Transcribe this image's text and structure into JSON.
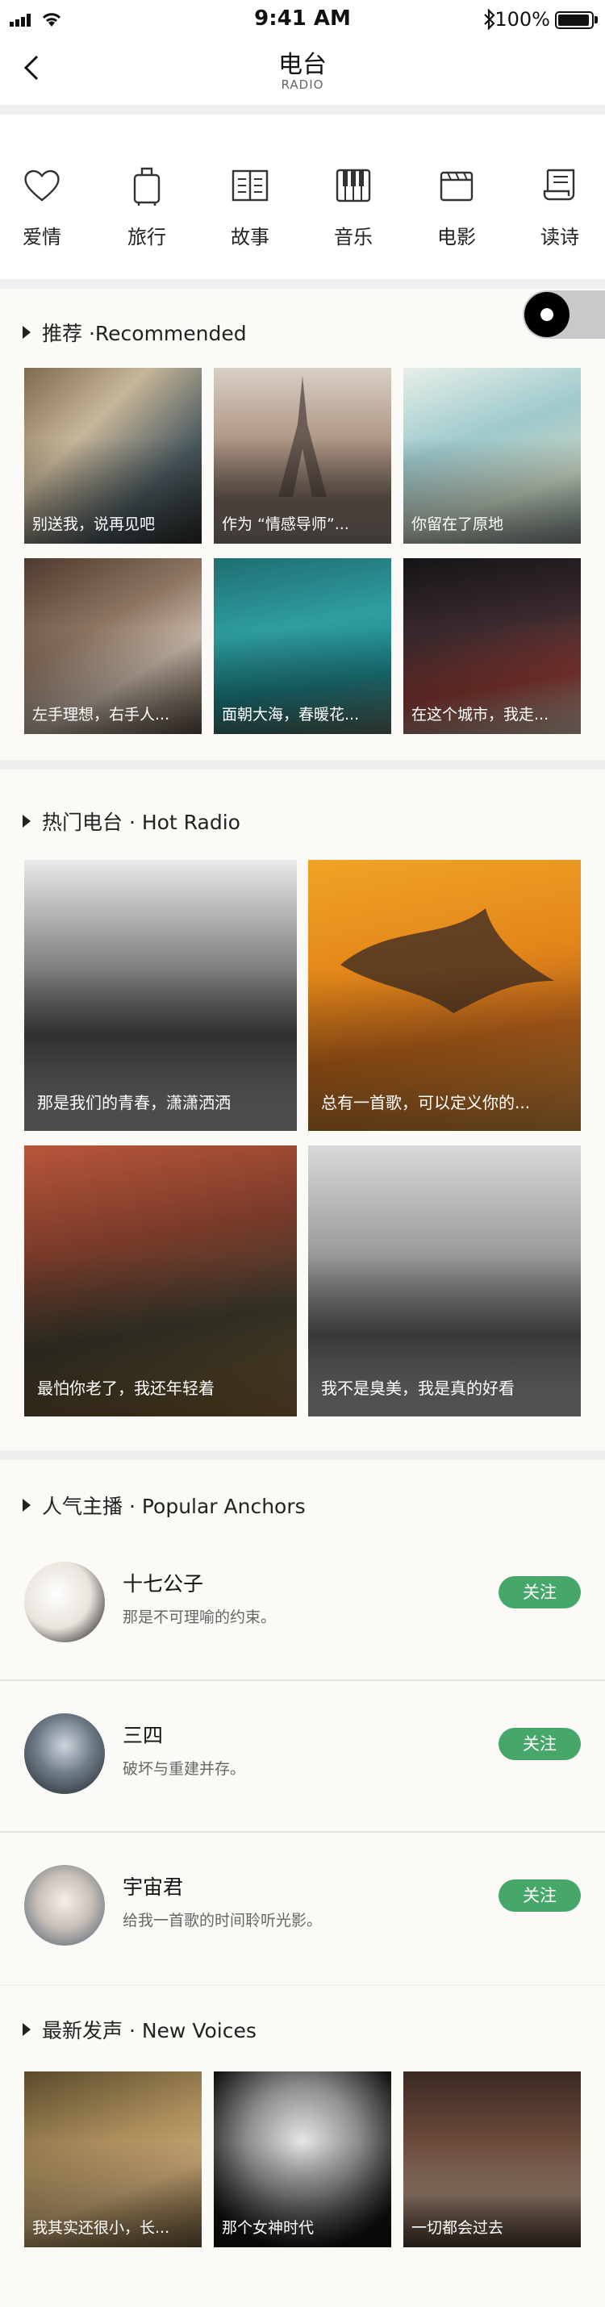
{
  "status_bar": {
    "time": "9:41 AM",
    "battery": "100%"
  },
  "header": {
    "title": "电台",
    "subtitle": "RADIO"
  },
  "categories": [
    {
      "label": "爱情",
      "icon": "heart-icon"
    },
    {
      "label": "旅行",
      "icon": "suitcase-icon"
    },
    {
      "label": "故事",
      "icon": "book-icon"
    },
    {
      "label": "音乐",
      "icon": "piano-icon"
    },
    {
      "label": "电影",
      "icon": "clapperboard-icon"
    },
    {
      "label": "读诗",
      "icon": "scroll-icon"
    }
  ],
  "recommended": {
    "title": "推荐 ·Recommended",
    "items": [
      {
        "caption": "别送我，说再见吧"
      },
      {
        "caption": "作为 “情感导师”..."
      },
      {
        "caption": "你留在了原地"
      },
      {
        "caption": "左手理想，右手人..."
      },
      {
        "caption": "面朝大海，春暖花..."
      },
      {
        "caption": "在这个城市，我走..."
      }
    ]
  },
  "hot_radio": {
    "title": "热门电台 · Hot Radio",
    "items": [
      {
        "caption": "那是我们的青春，潇潇洒洒"
      },
      {
        "caption": "总有一首歌，可以定义你的..."
      },
      {
        "caption": "最怕你老了，我还年轻着"
      },
      {
        "caption": "我不是臭美，我是真的好看"
      }
    ]
  },
  "anchors": {
    "title": "人气主播 · Popular Anchors",
    "follow_label": "关注",
    "items": [
      {
        "name": "十七公子",
        "desc": "那是不可理喻的约束。"
      },
      {
        "name": "三四",
        "desc": "破坏与重建并存。"
      },
      {
        "name": "宇宙君",
        "desc": "给我一首歌的时间聆听光影。"
      }
    ]
  },
  "new_voices": {
    "title": "最新发声 · New Voices",
    "items": [
      {
        "caption": "我其实还很小，长..."
      },
      {
        "caption": "那个女神时代"
      },
      {
        "caption": "一切都会过去"
      }
    ]
  },
  "colors": {
    "accent": "#47a76a",
    "section_bg": "#fbfaf7",
    "divider": "#efefef"
  }
}
